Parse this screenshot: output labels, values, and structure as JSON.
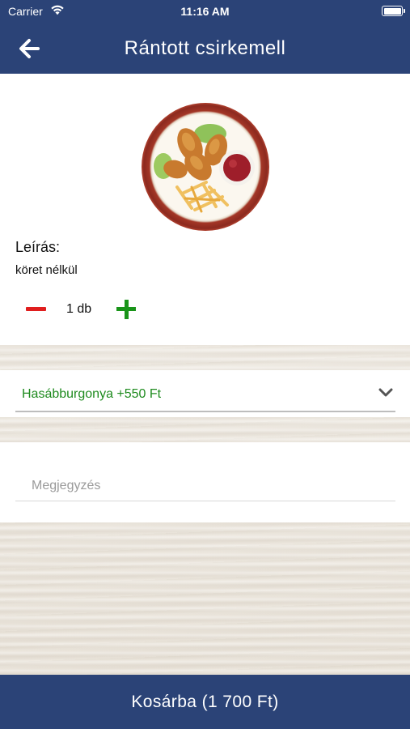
{
  "status_bar": {
    "carrier": "Carrier",
    "time": "11:16 AM"
  },
  "header": {
    "title": "Rántott csirkemell",
    "back_icon": "arrow-left-icon",
    "background_color": "#2b4377"
  },
  "product": {
    "image_icon": "fried-chicken-plate-image",
    "description_label": "Leírás:",
    "description_text": "köret nélkül",
    "quantity": "1 db",
    "minus_color": "#e01e1e",
    "plus_color": "#199419"
  },
  "side_dish": {
    "selected": "Hasábburgonya +550 Ft",
    "selected_color": "#1f8b1f"
  },
  "note": {
    "placeholder": "Megjegyzés",
    "value": ""
  },
  "cart_button": {
    "label": "Kosárba (1 700 Ft)"
  }
}
